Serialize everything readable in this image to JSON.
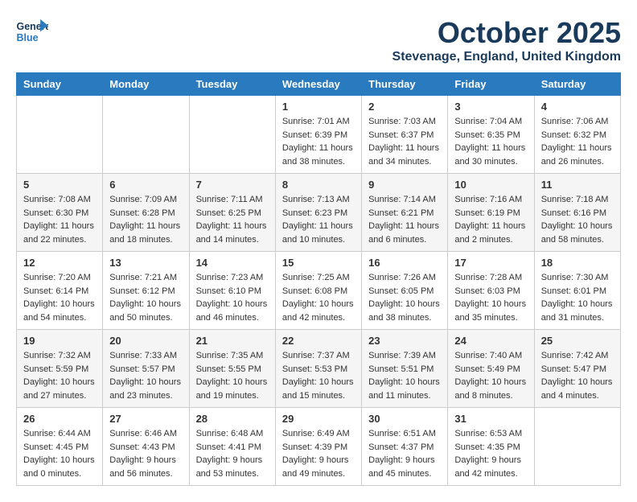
{
  "header": {
    "logo_general": "General",
    "logo_blue": "Blue",
    "month": "October 2025",
    "location": "Stevenage, England, United Kingdom"
  },
  "weekdays": [
    "Sunday",
    "Monday",
    "Tuesday",
    "Wednesday",
    "Thursday",
    "Friday",
    "Saturday"
  ],
  "weeks": [
    [
      {
        "day": "",
        "content": ""
      },
      {
        "day": "",
        "content": ""
      },
      {
        "day": "",
        "content": ""
      },
      {
        "day": "1",
        "content": "Sunrise: 7:01 AM\nSunset: 6:39 PM\nDaylight: 11 hours\nand 38 minutes."
      },
      {
        "day": "2",
        "content": "Sunrise: 7:03 AM\nSunset: 6:37 PM\nDaylight: 11 hours\nand 34 minutes."
      },
      {
        "day": "3",
        "content": "Sunrise: 7:04 AM\nSunset: 6:35 PM\nDaylight: 11 hours\nand 30 minutes."
      },
      {
        "day": "4",
        "content": "Sunrise: 7:06 AM\nSunset: 6:32 PM\nDaylight: 11 hours\nand 26 minutes."
      }
    ],
    [
      {
        "day": "5",
        "content": "Sunrise: 7:08 AM\nSunset: 6:30 PM\nDaylight: 11 hours\nand 22 minutes."
      },
      {
        "day": "6",
        "content": "Sunrise: 7:09 AM\nSunset: 6:28 PM\nDaylight: 11 hours\nand 18 minutes."
      },
      {
        "day": "7",
        "content": "Sunrise: 7:11 AM\nSunset: 6:25 PM\nDaylight: 11 hours\nand 14 minutes."
      },
      {
        "day": "8",
        "content": "Sunrise: 7:13 AM\nSunset: 6:23 PM\nDaylight: 11 hours\nand 10 minutes."
      },
      {
        "day": "9",
        "content": "Sunrise: 7:14 AM\nSunset: 6:21 PM\nDaylight: 11 hours\nand 6 minutes."
      },
      {
        "day": "10",
        "content": "Sunrise: 7:16 AM\nSunset: 6:19 PM\nDaylight: 11 hours\nand 2 minutes."
      },
      {
        "day": "11",
        "content": "Sunrise: 7:18 AM\nSunset: 6:16 PM\nDaylight: 10 hours\nand 58 minutes."
      }
    ],
    [
      {
        "day": "12",
        "content": "Sunrise: 7:20 AM\nSunset: 6:14 PM\nDaylight: 10 hours\nand 54 minutes."
      },
      {
        "day": "13",
        "content": "Sunrise: 7:21 AM\nSunset: 6:12 PM\nDaylight: 10 hours\nand 50 minutes."
      },
      {
        "day": "14",
        "content": "Sunrise: 7:23 AM\nSunset: 6:10 PM\nDaylight: 10 hours\nand 46 minutes."
      },
      {
        "day": "15",
        "content": "Sunrise: 7:25 AM\nSunset: 6:08 PM\nDaylight: 10 hours\nand 42 minutes."
      },
      {
        "day": "16",
        "content": "Sunrise: 7:26 AM\nSunset: 6:05 PM\nDaylight: 10 hours\nand 38 minutes."
      },
      {
        "day": "17",
        "content": "Sunrise: 7:28 AM\nSunset: 6:03 PM\nDaylight: 10 hours\nand 35 minutes."
      },
      {
        "day": "18",
        "content": "Sunrise: 7:30 AM\nSunset: 6:01 PM\nDaylight: 10 hours\nand 31 minutes."
      }
    ],
    [
      {
        "day": "19",
        "content": "Sunrise: 7:32 AM\nSunset: 5:59 PM\nDaylight: 10 hours\nand 27 minutes."
      },
      {
        "day": "20",
        "content": "Sunrise: 7:33 AM\nSunset: 5:57 PM\nDaylight: 10 hours\nand 23 minutes."
      },
      {
        "day": "21",
        "content": "Sunrise: 7:35 AM\nSunset: 5:55 PM\nDaylight: 10 hours\nand 19 minutes."
      },
      {
        "day": "22",
        "content": "Sunrise: 7:37 AM\nSunset: 5:53 PM\nDaylight: 10 hours\nand 15 minutes."
      },
      {
        "day": "23",
        "content": "Sunrise: 7:39 AM\nSunset: 5:51 PM\nDaylight: 10 hours\nand 11 minutes."
      },
      {
        "day": "24",
        "content": "Sunrise: 7:40 AM\nSunset: 5:49 PM\nDaylight: 10 hours\nand 8 minutes."
      },
      {
        "day": "25",
        "content": "Sunrise: 7:42 AM\nSunset: 5:47 PM\nDaylight: 10 hours\nand 4 minutes."
      }
    ],
    [
      {
        "day": "26",
        "content": "Sunrise: 6:44 AM\nSunset: 4:45 PM\nDaylight: 10 hours\nand 0 minutes."
      },
      {
        "day": "27",
        "content": "Sunrise: 6:46 AM\nSunset: 4:43 PM\nDaylight: 9 hours\nand 56 minutes."
      },
      {
        "day": "28",
        "content": "Sunrise: 6:48 AM\nSunset: 4:41 PM\nDaylight: 9 hours\nand 53 minutes."
      },
      {
        "day": "29",
        "content": "Sunrise: 6:49 AM\nSunset: 4:39 PM\nDaylight: 9 hours\nand 49 minutes."
      },
      {
        "day": "30",
        "content": "Sunrise: 6:51 AM\nSunset: 4:37 PM\nDaylight: 9 hours\nand 45 minutes."
      },
      {
        "day": "31",
        "content": "Sunrise: 6:53 AM\nSunset: 4:35 PM\nDaylight: 9 hours\nand 42 minutes."
      },
      {
        "day": "",
        "content": ""
      }
    ]
  ]
}
